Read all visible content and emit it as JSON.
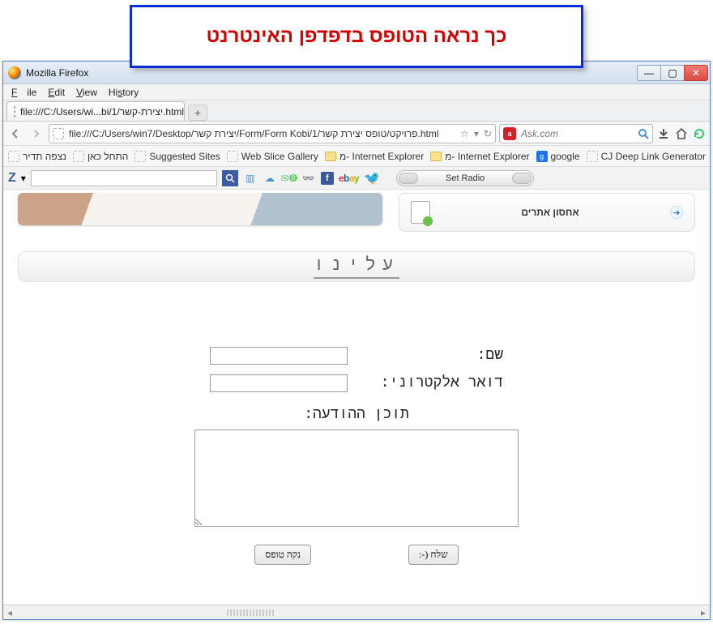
{
  "caption": "כך נראה הטופס בדפדפן האינטרנט",
  "window_title": "Mozilla Firefox",
  "menu": {
    "file": "File",
    "edit": "Edit",
    "view": "View",
    "history": "History"
  },
  "tab": {
    "label": "file:///C:/Users/wi...bi/1/יצירת-קשר.html"
  },
  "address": "file:///C:/Users/win7/Desktop/יצירת קשר/Form/Form Kobi/1/פרויקט/טופס יצירת קשר.html",
  "search": {
    "engine_initial": "a",
    "placeholder": "Ask.com"
  },
  "bookmarks": {
    "b1": "נצפה תדיר",
    "b2": "התחל כאן",
    "b3": "Suggested Sites",
    "b4": "Web Slice Gallery",
    "b5": "מ- Internet Explorer",
    "b6": "מ- Internet Explorer",
    "b7": "google",
    "b8": "CJ Deep Link Generator"
  },
  "toolbar2": {
    "logo": "Z",
    "arrow": "▾",
    "set_radio": "Set Radio"
  },
  "page": {
    "side_label": "אחסון אתרים",
    "about_heading": "עלינו",
    "form": {
      "name_label": "שם:",
      "email_label": "דואר אלקטרוני:",
      "message_label": "תוכן ההודעה:",
      "clear_btn": "נקה טופס",
      "send_btn": "שלח (-:"
    }
  },
  "win": {
    "min": "—",
    "max": "▢",
    "close": "✕"
  }
}
